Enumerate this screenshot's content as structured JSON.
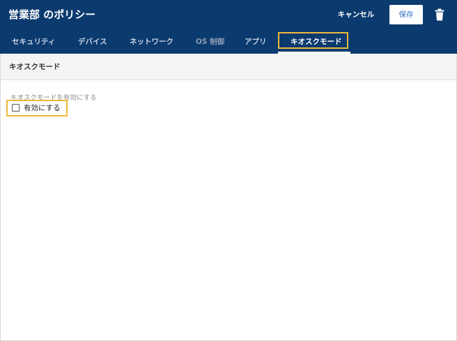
{
  "header": {
    "title": "営業部 のポリシー",
    "cancel_label": "キャンセル",
    "save_label": "保存",
    "delete_icon": "trash-icon",
    "colors": {
      "background": "#0b3a6e",
      "highlight": "#f0b93c"
    }
  },
  "tabs": [
    {
      "label": "セキュリティ",
      "active": false
    },
    {
      "label": "デバイス",
      "active": false
    },
    {
      "label": "ネットワーク",
      "active": false
    },
    {
      "label": "OS 制御",
      "active": false
    },
    {
      "label": "アプリ",
      "active": false
    },
    {
      "label": "キオスクモード",
      "active": true
    }
  ],
  "section": {
    "title": "キオスクモード"
  },
  "kiosk": {
    "field_label": "キオスクモードを有効にする",
    "checkbox_label": "有効にする",
    "checked": false
  }
}
